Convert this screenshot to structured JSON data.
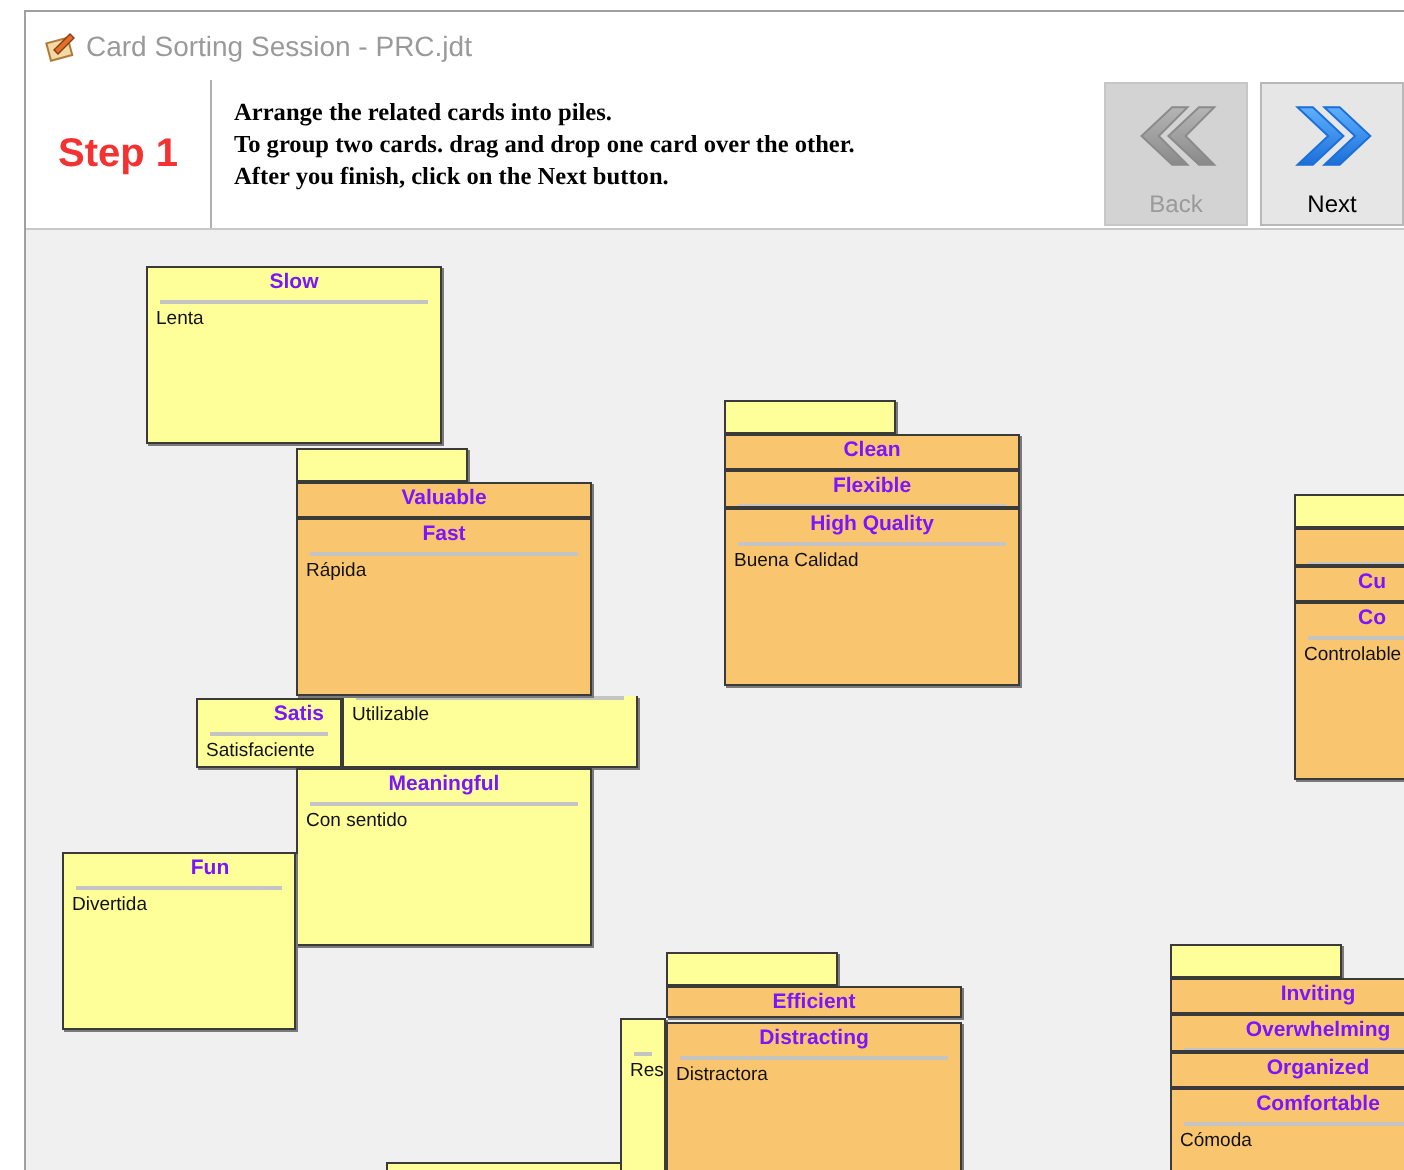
{
  "window": {
    "title": "Card Sorting Session - PRC.jdt"
  },
  "step": {
    "label": "Step 1"
  },
  "instructions": [
    "Arrange the related cards into piles.",
    "To group two cards. drag and drop one card over the other.",
    "After you finish, click on the Next button."
  ],
  "buttons": [
    {
      "kind": "back",
      "label": "Back",
      "disabled": true
    },
    {
      "kind": "next",
      "label": "Next",
      "disabled": false
    }
  ],
  "cards": [
    {
      "title": "Slow",
      "text": "Lenta",
      "color": "#ffff99"
    },
    {
      "color": "#ffff99"
    },
    {
      "title": "Satis",
      "text": "Satisfaciente",
      "color": "#ffff99"
    },
    {
      "text": "Utilizable",
      "color": "#ffff99"
    },
    {
      "title": "Valuable",
      "color": "#f9c66f"
    },
    {
      "title": "Fast",
      "text": "Rápida",
      "color": "#f9c66f"
    },
    {
      "title": "Meaningful",
      "text": "Con sentido",
      "color": "#ffff99"
    },
    {
      "title": "Fun",
      "text": "Divertida",
      "color": "#ffff99"
    },
    {
      "color": "#ffff99"
    },
    {
      "title": "Clean",
      "color": "#f9c66f"
    },
    {
      "title": "Flexible",
      "color": "#f9c66f"
    },
    {
      "title": "High Quality",
      "text": "Buena Calidad",
      "color": "#f9c66f"
    },
    {
      "color": "#ffff99"
    },
    {
      "color": "#f9c66f"
    },
    {
      "title": "Cu",
      "color": "#f9c66f"
    },
    {
      "title": "Co",
      "text": "Controlable",
      "color": "#f9c66f"
    },
    {
      "color": "#ffff99"
    },
    {
      "color": "#ffff99"
    },
    {
      "title": "Efficient",
      "color": "#f9c66f"
    },
    {
      "text": "Res",
      "color": "#ffff99"
    },
    {
      "title": "Distracting",
      "text": "Distractora",
      "color": "#f9c66f"
    },
    {
      "color": "#ffff99"
    },
    {
      "title": "Inviting",
      "color": "#f9c66f"
    },
    {
      "title": "Overwhelming",
      "color": "#f9c66f"
    },
    {
      "title": "Organized",
      "color": "#f9c66f"
    },
    {
      "title": "Comfortable",
      "text": "Cómoda",
      "color": "#f9c66f"
    }
  ]
}
